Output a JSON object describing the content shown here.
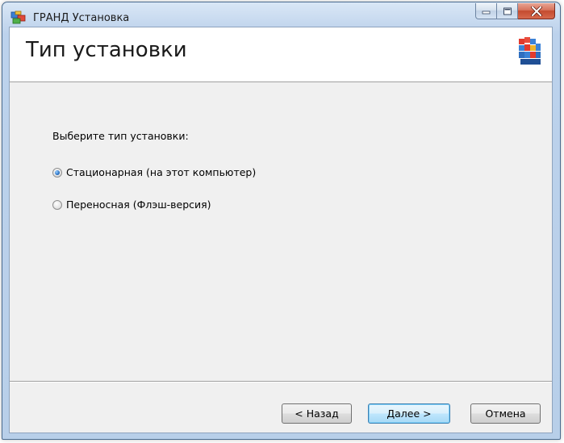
{
  "window": {
    "title": "ГРАНД Установка",
    "icons": {
      "app": "grand-app-icon",
      "minimize": "minimize-icon",
      "maximize": "maximize-icon",
      "close": "close-icon",
      "logo": "grand-cubes-logo-icon"
    },
    "colors": {
      "close_button": "#c44b2f",
      "titlebar": "#c4d7ee",
      "client_bg": "#f0f0f0"
    }
  },
  "header": {
    "title": "Тип установки"
  },
  "body": {
    "prompt": "Выберите тип установки:",
    "options": [
      {
        "label": "Стационарная (на этот компьютер)",
        "selected": true
      },
      {
        "label": "Переносная (Флэш-версия)",
        "selected": false
      }
    ]
  },
  "buttons": {
    "back": "< Назад",
    "next": "Далее >",
    "cancel": "Отмена"
  }
}
